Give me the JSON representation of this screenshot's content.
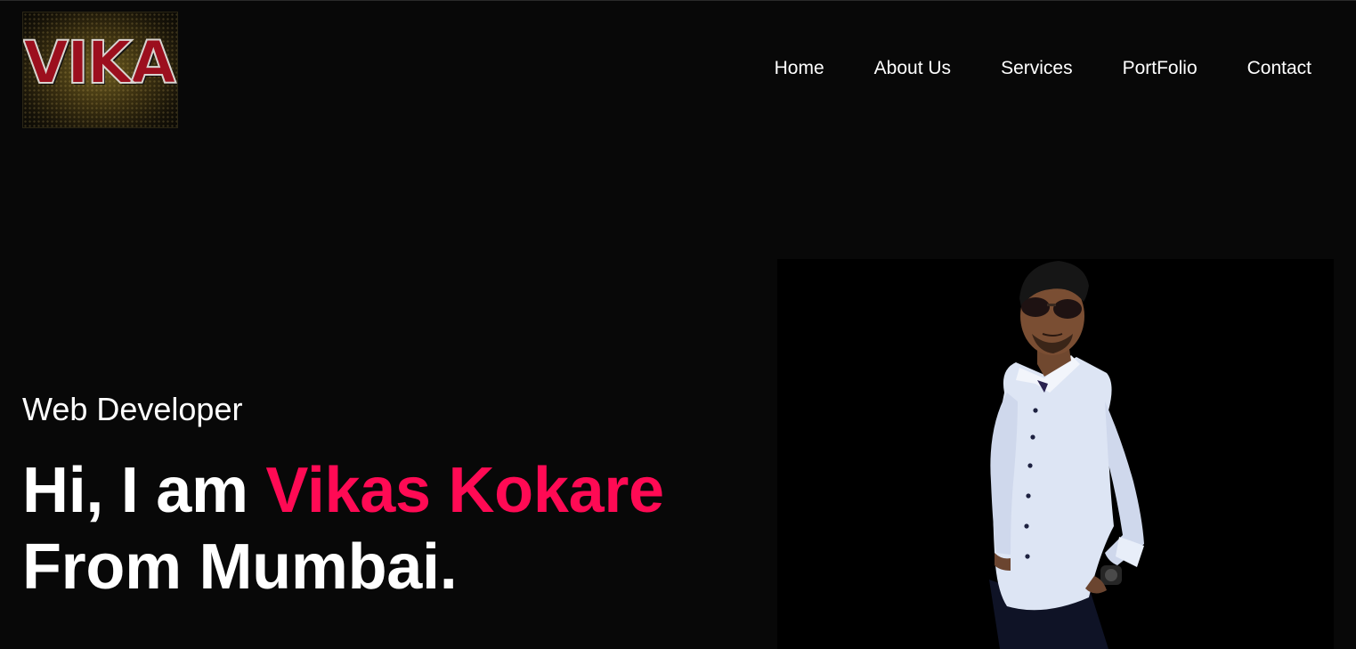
{
  "logo": {
    "text": "VIKAS"
  },
  "nav": {
    "items": [
      {
        "label": "Home"
      },
      {
        "label": "About Us"
      },
      {
        "label": "Services"
      },
      {
        "label": "PortFolio"
      },
      {
        "label": "Contact"
      }
    ]
  },
  "hero": {
    "subtitle": "Web Developer",
    "greeting": "Hi, I am ",
    "name": "Vikas Kokare",
    "location": "From Mumbai."
  },
  "colors": {
    "background": "#080808",
    "accent": "#ff0a54",
    "text": "#ffffff"
  }
}
